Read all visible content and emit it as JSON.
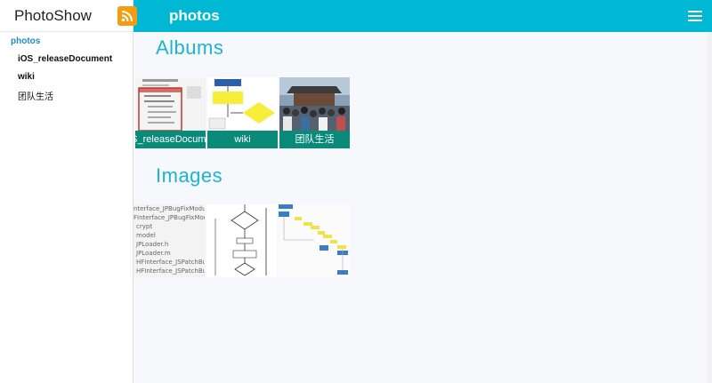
{
  "app": {
    "title": "PhotoShow"
  },
  "header": {
    "title": "photos"
  },
  "sidebar": {
    "root": "photos",
    "items": [
      {
        "label": "iOS_releaseDocument"
      },
      {
        "label": "wiki"
      },
      {
        "label": "团队生活"
      }
    ]
  },
  "sections": {
    "albums": "Albums",
    "images": "Images"
  },
  "albums": [
    {
      "label": "iOS_releaseDocument"
    },
    {
      "label": "wiki"
    },
    {
      "label": "团队生活"
    }
  ],
  "image_code_lines": [
    "nterface_JPBugFixModule",
    "FInterface_JPBugFixModuleLi",
    "crypt",
    "model",
    "JPLoader.h",
    "JPLoader.m",
    "HFInterface_JSPatchBugFixM",
    "HFInterface_JSPatchBugFixM"
  ],
  "colors": {
    "accent": "#00b8d4",
    "caption": "#0a8b7a",
    "rss": "#f39c12",
    "active": "#1e8ad6"
  }
}
